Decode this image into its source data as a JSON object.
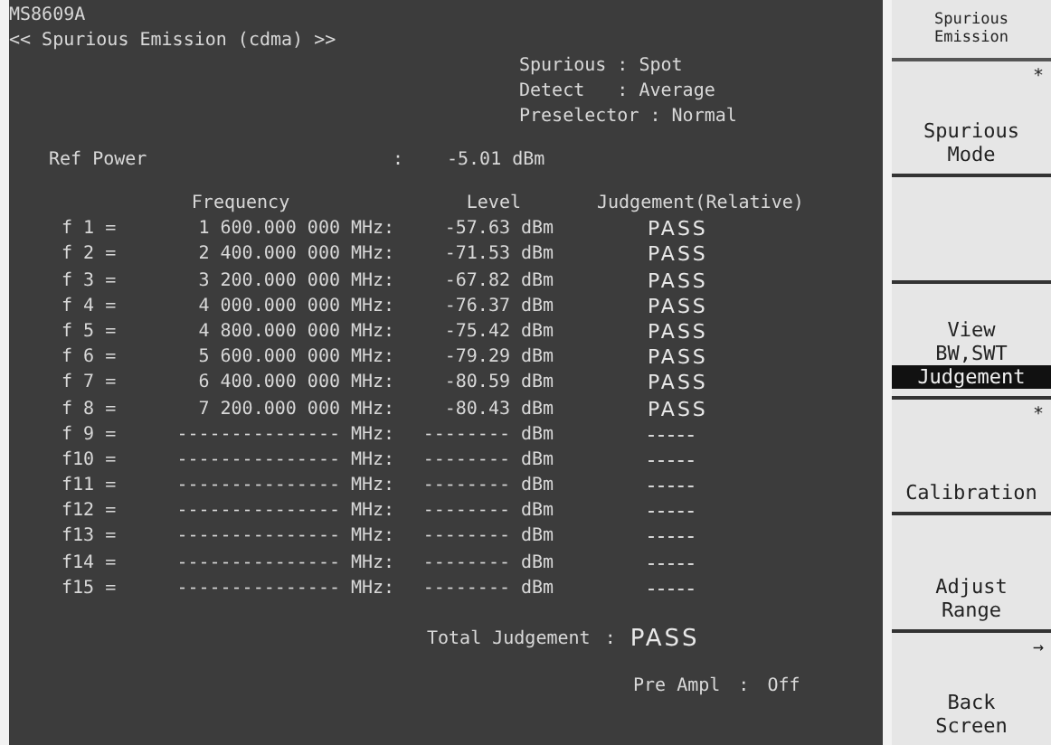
{
  "header": {
    "model": "MS8609A",
    "title": "<< Spurious Emission (cdma) >>"
  },
  "settings": [
    "Spurious : Spot",
    "Detect   : Average",
    "Preselector : Normal"
  ],
  "ref_power": {
    "label": "Ref Power",
    "separator": ":",
    "value": "-5.01 dBm"
  },
  "table": {
    "columns": [
      "Frequency",
      "Level",
      "Judgement(Relative)"
    ],
    "rows": [
      {
        "label": "f 1 =",
        "frequency": "1 600.000 000",
        "frequency_unit": "MHz:",
        "level": "-57.63",
        "level_unit": "dBm",
        "judgement": "PASS"
      },
      {
        "label": "f 2 =",
        "frequency": "2 400.000 000",
        "frequency_unit": "MHz:",
        "level": "-71.53",
        "level_unit": "dBm",
        "judgement": "PASS"
      },
      {
        "label": "f 3 =",
        "frequency": "3 200.000 000",
        "frequency_unit": "MHz:",
        "level": "-67.82",
        "level_unit": "dBm",
        "judgement": "PASS"
      },
      {
        "label": "f 4 =",
        "frequency": "4 000.000 000",
        "frequency_unit": "MHz:",
        "level": "-76.37",
        "level_unit": "dBm",
        "judgement": "PASS"
      },
      {
        "label": "f 5 =",
        "frequency": "4 800.000 000",
        "frequency_unit": "MHz:",
        "level": "-75.42",
        "level_unit": "dBm",
        "judgement": "PASS"
      },
      {
        "label": "f 6 =",
        "frequency": "5 600.000 000",
        "frequency_unit": "MHz:",
        "level": "-79.29",
        "level_unit": "dBm",
        "judgement": "PASS"
      },
      {
        "label": "f 7 =",
        "frequency": "6 400.000 000",
        "frequency_unit": "MHz:",
        "level": "-80.59",
        "level_unit": "dBm",
        "judgement": "PASS"
      },
      {
        "label": "f 8 =",
        "frequency": "7 200.000 000",
        "frequency_unit": "MHz:",
        "level": "-80.43",
        "level_unit": "dBm",
        "judgement": "PASS"
      },
      {
        "label": "f 9 =",
        "frequency": "---------------",
        "frequency_unit": "MHz:",
        "level": "--------",
        "level_unit": "dBm",
        "judgement": "-----"
      },
      {
        "label": "f10 =",
        "frequency": "---------------",
        "frequency_unit": "MHz:",
        "level": "--------",
        "level_unit": "dBm",
        "judgement": "-----"
      },
      {
        "label": "f11 =",
        "frequency": "---------------",
        "frequency_unit": "MHz:",
        "level": "--------",
        "level_unit": "dBm",
        "judgement": "-----"
      },
      {
        "label": "f12 =",
        "frequency": "---------------",
        "frequency_unit": "MHz:",
        "level": "--------",
        "level_unit": "dBm",
        "judgement": "-----"
      },
      {
        "label": "f13 =",
        "frequency": "---------------",
        "frequency_unit": "MHz:",
        "level": "--------",
        "level_unit": "dBm",
        "judgement": "-----"
      },
      {
        "label": "f14 =",
        "frequency": "---------------",
        "frequency_unit": "MHz:",
        "level": "--------",
        "level_unit": "dBm",
        "judgement": "-----"
      },
      {
        "label": "f15 =",
        "frequency": "---------------",
        "frequency_unit": "MHz:",
        "level": "--------",
        "level_unit": "dBm",
        "judgement": "-----"
      }
    ]
  },
  "total_judgement": {
    "label": "Total Judgement",
    "separator": ":",
    "value": "PASS"
  },
  "pre_ampl": {
    "label": "Pre Ampl",
    "separator": ":",
    "value": "Off"
  },
  "softkey_menu": {
    "title": "Spurious Emission",
    "keys": [
      {
        "marker": "*",
        "lines": [
          "Spurious",
          "Mode"
        ]
      },
      {
        "gap_before": true,
        "title": "View",
        "options": [
          {
            "label": "BW,SWT",
            "selected": false
          },
          {
            "label": "Judgement",
            "selected": true
          }
        ]
      },
      {
        "marker": "*",
        "lines": [
          "Calibration"
        ]
      },
      {
        "lines": [
          "Adjust",
          "Range"
        ]
      },
      {
        "marker": "→",
        "lines": [
          "Back",
          "Screen"
        ]
      }
    ]
  }
}
